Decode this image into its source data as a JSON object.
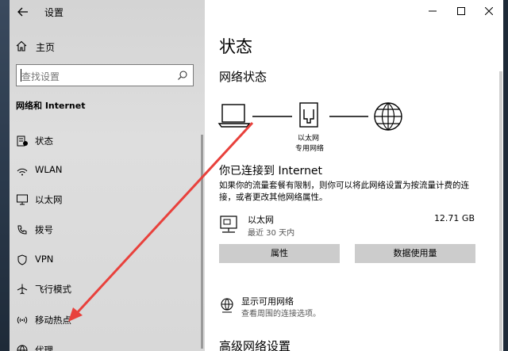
{
  "window": {
    "title": "设置",
    "controls": {
      "minimize": "minimize-icon",
      "maximize": "maximize-icon",
      "close": "close-icon"
    }
  },
  "sidebar": {
    "home_label": "主页",
    "search_placeholder": "查找设置",
    "section_title": "网络和 Internet",
    "items": [
      {
        "label": "状态",
        "icon": "status-icon"
      },
      {
        "label": "WLAN",
        "icon": "wifi-icon"
      },
      {
        "label": "以太网",
        "icon": "ethernet-icon"
      },
      {
        "label": "拨号",
        "icon": "dialup-icon"
      },
      {
        "label": "VPN",
        "icon": "vpn-icon"
      },
      {
        "label": "飞行模式",
        "icon": "airplane-icon"
      },
      {
        "label": "移动热点",
        "icon": "hotspot-icon"
      },
      {
        "label": "代理",
        "icon": "globe-icon"
      }
    ]
  },
  "main": {
    "page_title": "状态",
    "network_status_heading": "网络状态",
    "diagram": {
      "adapter_label_1": "以太网",
      "adapter_label_2": "专用网络"
    },
    "connected_title": "你已连接到 Internet",
    "connected_desc": "如果你的流量套餐有限制，则你可以将此网络设置为按流量计费的连接，或者更改其他网络属性。",
    "network": {
      "name": "以太网",
      "subtitle": "最近 30 天内",
      "usage": "12.71 GB"
    },
    "buttons": {
      "properties": "属性",
      "data_usage": "数据使用量"
    },
    "available": {
      "title": "显示可用网络",
      "desc": "查看周围的连接选项。"
    },
    "advanced_heading": "高级网络设置"
  },
  "annotation": {
    "arrow_color": "#e8413c"
  },
  "colors": {
    "sidebar_bg": "#d8d8d8",
    "button_bg": "#cccccc"
  }
}
